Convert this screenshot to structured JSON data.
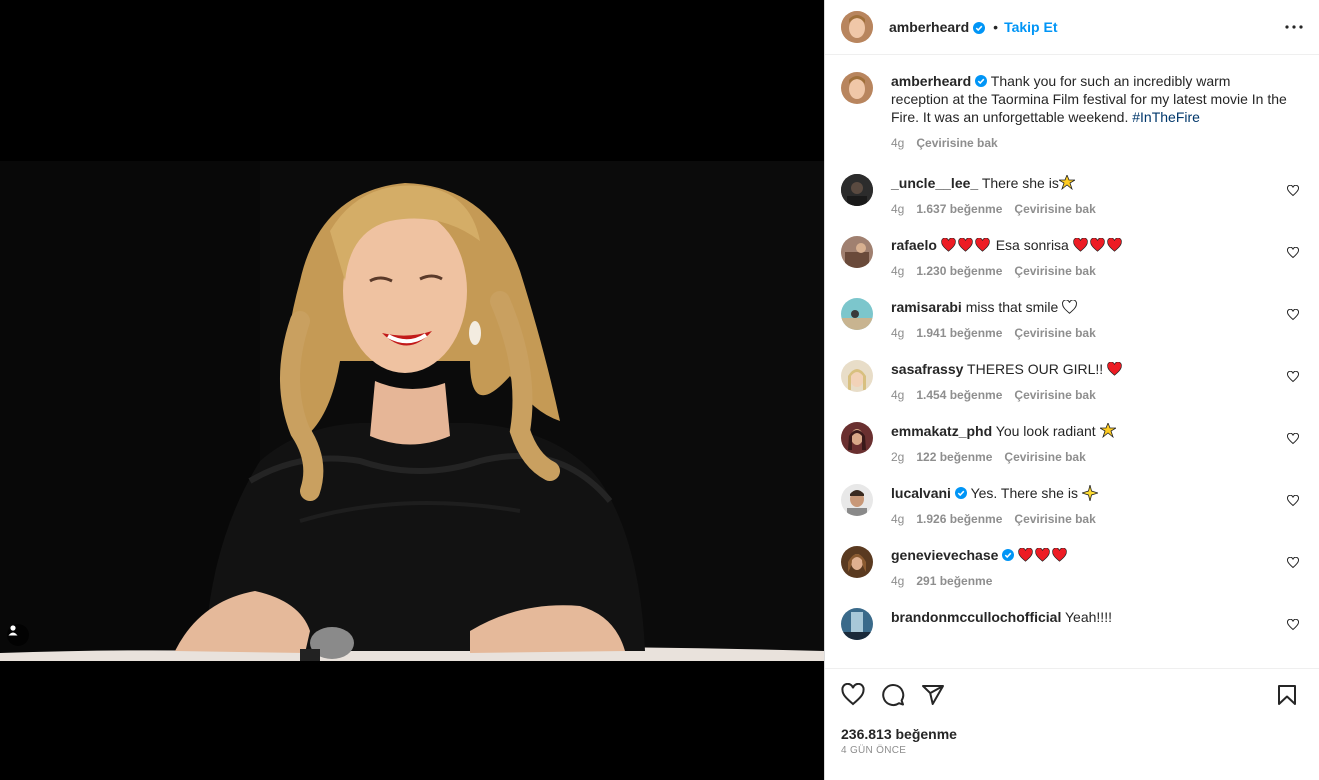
{
  "post": {
    "username": "amberheard",
    "dot": "•",
    "follow_label": "Takip Et",
    "caption_text": "Thank you for such an incredibly warm reception at the Taormina Film festival for my latest movie In the Fire. It was an unforgettable weekend.",
    "caption_hashtag": "#InTheFire",
    "caption_time": "4g",
    "caption_translate": "Çevirisine bak",
    "likes": "236.813 beğenme",
    "time_ago": "4 GÜN ÖNCE"
  },
  "comments": [
    {
      "username": "_uncle__lee_",
      "text": "There she is",
      "time": "4g",
      "likes": "1.637 beğenme",
      "translate": "Çevirisine bak",
      "avatar_color": "#3a3a3a"
    },
    {
      "username": "rafaelo",
      "text": "Esa sonrisa",
      "time": "4g",
      "likes": "1.230 beğenme",
      "translate": "Çevirisine bak",
      "avatar_color": "#8a6a5a"
    },
    {
      "username": "ramisarabi",
      "text": "miss that smile",
      "time": "4g",
      "likes": "1.941 beğenme",
      "translate": "Çevirisine bak",
      "avatar_color": "#5bb0b8"
    },
    {
      "username": "sasafrassy",
      "text": "THERES OUR GIRL!!",
      "time": "4g",
      "likes": "1.454 beğenme",
      "translate": "Çevirisine bak",
      "avatar_color": "#c9b79a"
    },
    {
      "username": "emmakatz_phd",
      "text": "You look radiant",
      "time": "2g",
      "likes": "122 beğenme",
      "translate": "Çevirisine bak",
      "avatar_color": "#6b3a3a"
    },
    {
      "username": "lucalvani",
      "text": "Yes. There she is",
      "time": "4g",
      "likes": "1.926 beğenme",
      "translate": "Çevirisine bak",
      "avatar_color": "#9a8a7a"
    },
    {
      "username": "genevievechase",
      "text": "",
      "time": "4g",
      "likes": "291 beğenme",
      "translate": "",
      "avatar_color": "#7a5a3a"
    },
    {
      "username": "brandonmccullochofficial",
      "text": "Yeah!!!!",
      "time": "4g",
      "likes": "",
      "translate": "",
      "avatar_color": "#4a7a9a"
    }
  ],
  "colors": {
    "accent": "#0095f6",
    "verified": "#0095f6",
    "heart_red": "#ed1c24",
    "text_secondary": "#8e8e8e"
  },
  "icons": [
    "more-icon",
    "verified-icon",
    "heart-icon",
    "comment-icon",
    "share-icon",
    "save-icon",
    "user-tag-icon"
  ]
}
